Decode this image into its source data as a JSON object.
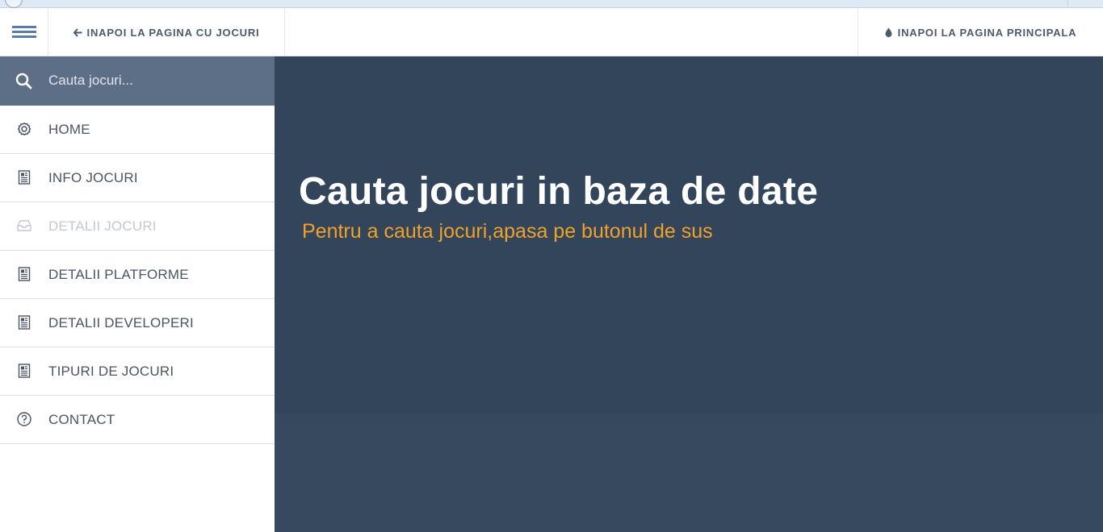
{
  "header": {
    "back_games_label": "INAPOI LA PAGINA CU JOCURI",
    "back_home_label": "INAPOI LA PAGINA PRINCIPALA"
  },
  "search": {
    "placeholder": "Cauta jocuri...",
    "value": ""
  },
  "sidebar": {
    "items": [
      {
        "label": "HOME",
        "icon": "gear-icon"
      },
      {
        "label": "INFO JOCURI",
        "icon": "document-icon"
      },
      {
        "label": "DETALII JOCURI",
        "icon": "inbox-icon",
        "state": "disabled"
      },
      {
        "label": "DETALII PLATFORME",
        "icon": "document-icon"
      },
      {
        "label": "DETALII DEVELOPERI",
        "icon": "document-icon"
      },
      {
        "label": "TIPURI DE JOCURI",
        "icon": "document-icon"
      },
      {
        "label": "CONTACT",
        "icon": "help-circle-icon"
      }
    ]
  },
  "main": {
    "title": "Cauta jocuri in baza de date",
    "subtitle": "Pentru a cauta jocuri,apasa pe butonul de sus"
  },
  "colors": {
    "accent_orange": "#f0a12b",
    "main_bg": "#32455a",
    "search_bg": "#5d6f86",
    "menu_icon": "#5b7aa6"
  }
}
